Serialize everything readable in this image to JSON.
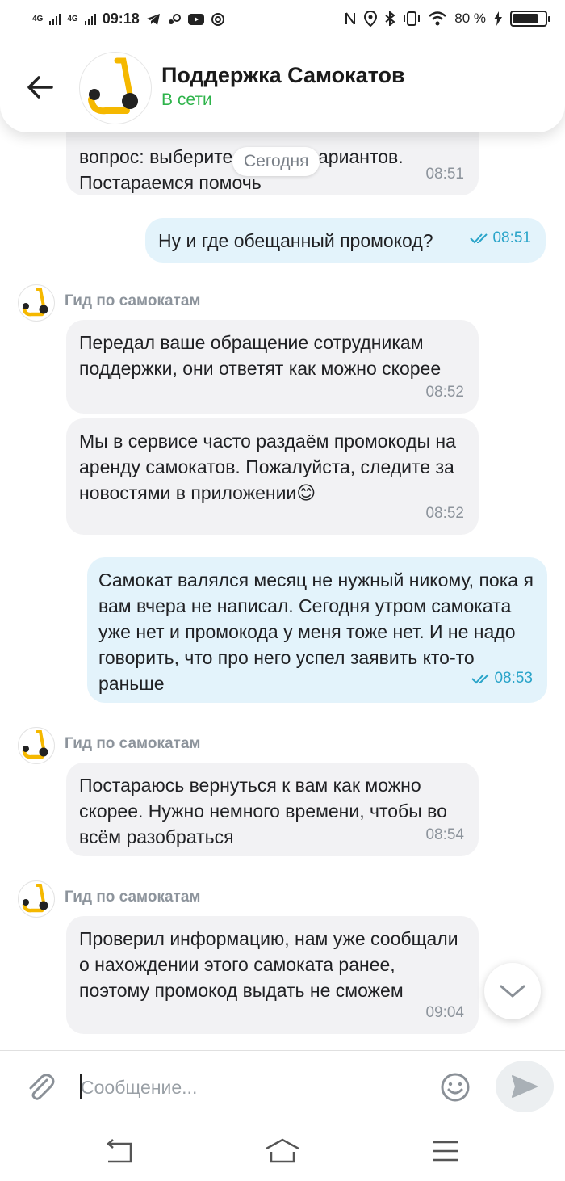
{
  "status_bar": {
    "net1": "4G",
    "net2": "4G",
    "time": "09:18",
    "battery": "80 %",
    "battery_level": 0.8
  },
  "header": {
    "title": "Поддержка Самокатов",
    "status": "В сети"
  },
  "date_separator": "Сегодня",
  "messages": [
    {
      "direction": "incoming",
      "text_line1": "вопрос: выберите один из вариантов.",
      "text_line2": "Постараемся помочь",
      "time": "08:51"
    },
    {
      "direction": "outgoing",
      "text": "Ну и где обещанный промокод?",
      "time": "08:51"
    },
    {
      "direction": "incoming",
      "sender": "Гид по самокатам",
      "text": "Передал ваше обращение сотрудникам поддержки, они ответят как можно скорее",
      "time": "08:52"
    },
    {
      "direction": "incoming",
      "text": "Мы в сервисе часто раздаём промокоды на аренду самокатов. Пожалуйста, следите за новостями в приложении😊",
      "time": "08:52"
    },
    {
      "direction": "outgoing",
      "text": "Самокат валялся месяц не нужный никому, пока я вам вчера не написал. Сегодня утром самоката уже нет и промокода у меня тоже нет.  И не надо говорить, что про него успел заявить кто-то раньше",
      "time": "08:53"
    },
    {
      "direction": "incoming",
      "sender": "Гид по самокатам",
      "text": "Постараюсь вернуться к вам как можно скорее. Нужно немного времени, чтобы во всём разобраться",
      "time": "08:54"
    },
    {
      "direction": "incoming",
      "sender": "Гид по самокатам",
      "text": "Проверил информацию, нам уже сообщали о нахождении этого самоката ранее, поэтому промокод выдать не сможем",
      "time": "09:04"
    }
  ],
  "input": {
    "placeholder": "Сообщение..."
  },
  "icons": {
    "back": "arrow-left-icon",
    "scroll": "chevron-down-icon",
    "attach": "paperclip-icon",
    "emoji": "smiley-icon",
    "send": "send-icon"
  },
  "colors": {
    "online": "#2db34a",
    "outgoing_bubble": "#e3f3fb",
    "incoming_bubble": "#f2f2f4",
    "read_ticks": "#2aa4c9",
    "brand_yellow": "#f5b800"
  }
}
